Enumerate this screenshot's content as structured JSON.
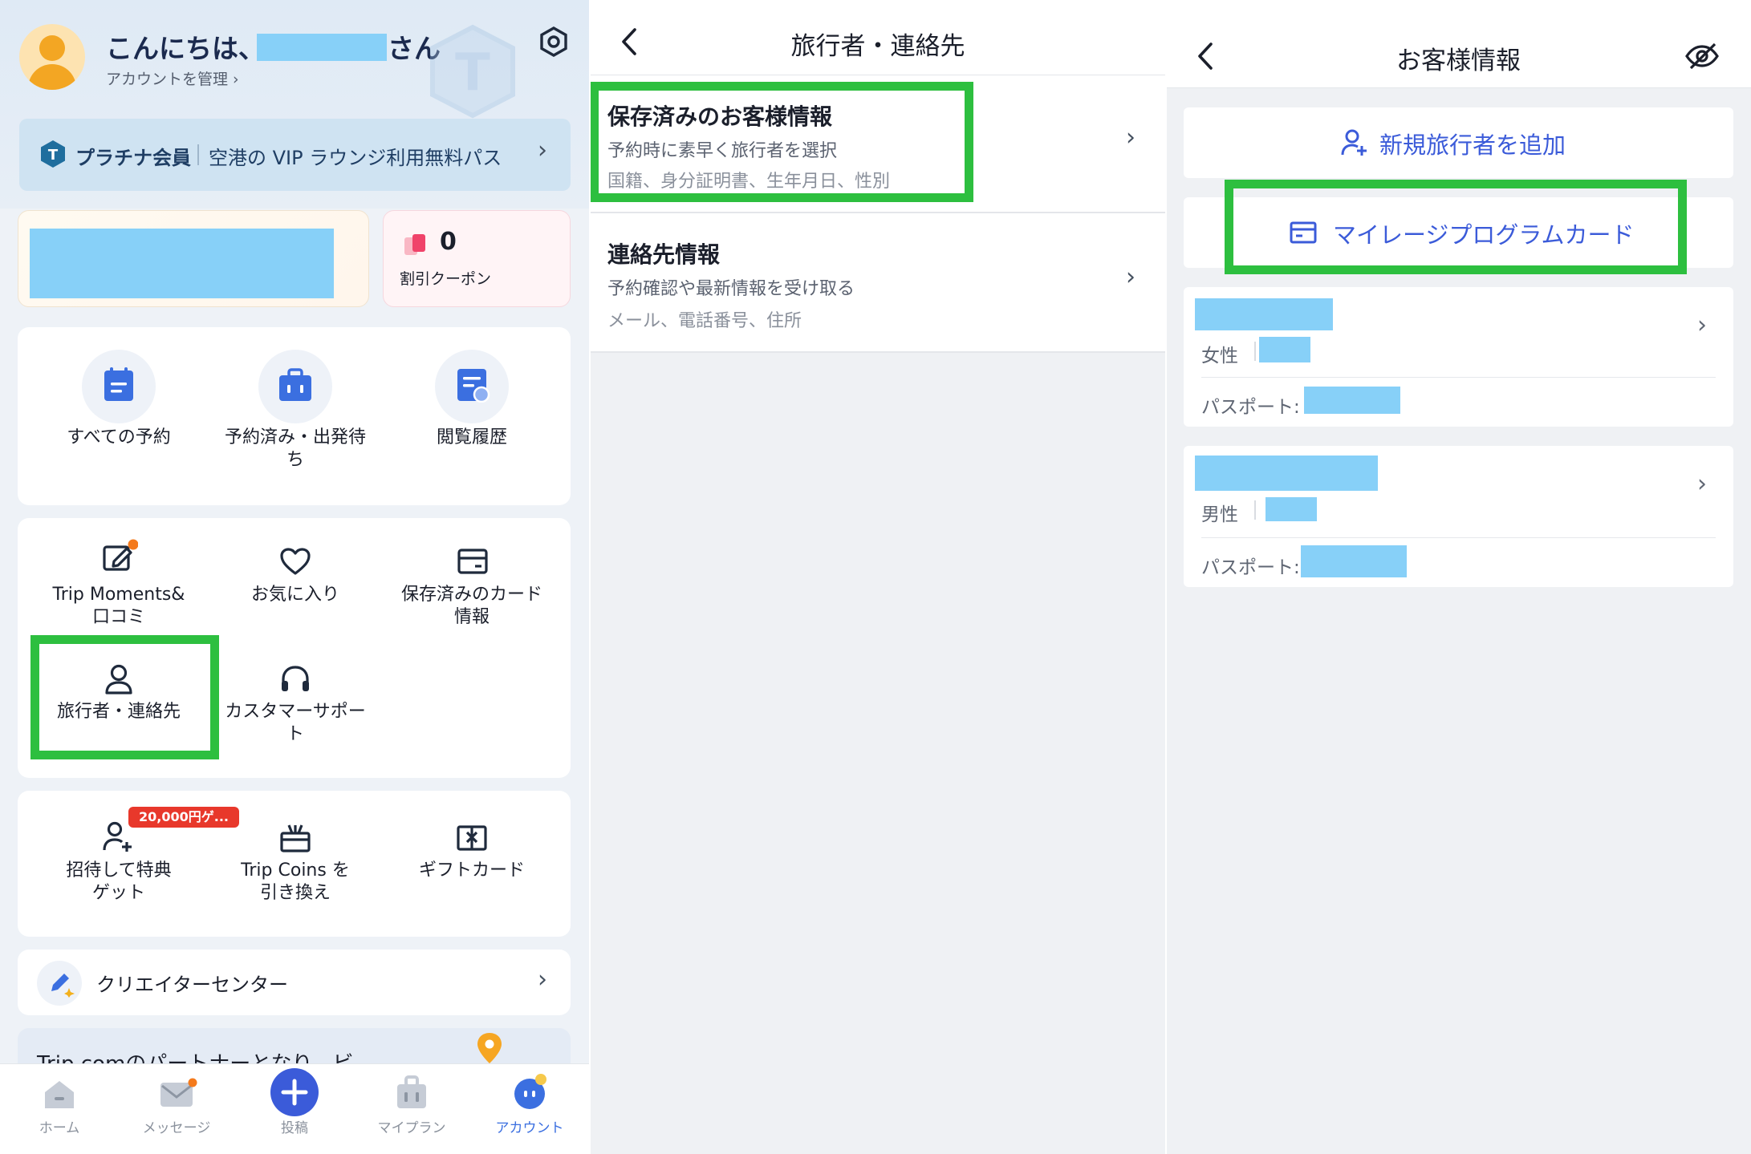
{
  "panel1": {
    "greeting": "こんにちは、",
    "greeting_suffix": "さん",
    "manage_account": "アカウントを管理 ›",
    "vip_badge_letter": "T",
    "vip_title": "プラチナ会員",
    "vip_subtitle": "空港の VIP ラウンジ利用無料パス",
    "coupon_count": "0",
    "coupon_label": "割引クーポン",
    "grid1": [
      {
        "label": "すべての予約",
        "icon": "calendar-icon"
      },
      {
        "label": "予約済み・出発待\nち",
        "icon": "suitcase-icon"
      },
      {
        "label": "閲覧履歴",
        "icon": "history-icon"
      }
    ],
    "grid2": [
      {
        "label": "Trip Moments&\n口コミ",
        "icon": "edit-note-icon"
      },
      {
        "label": "お気に入り",
        "icon": "heart-icon"
      },
      {
        "label": "保存済みのカード\n情報",
        "icon": "card-icon"
      },
      {
        "label": "旅行者・連絡先",
        "icon": "person-icon"
      },
      {
        "label": "カスタマーサポー\nト",
        "icon": "headset-icon"
      }
    ],
    "grid3": [
      {
        "label": "招待して特典\nゲット",
        "icon": "invite-icon",
        "badge": "20,000円ゲ..."
      },
      {
        "label": "Trip Coins を\n引き換え",
        "icon": "gift-box-icon"
      },
      {
        "label": "ギフトカード",
        "icon": "gift-card-icon"
      }
    ],
    "creator_center": "クリエイターセンター",
    "partner_banner": "Trip.comのパートナーとなり、ビ",
    "tabs": [
      {
        "label": "ホーム",
        "icon": "home-icon"
      },
      {
        "label": "メッセージ",
        "icon": "mail-icon"
      },
      {
        "label": "投稿",
        "icon": "plus-icon"
      },
      {
        "label": "マイプラン",
        "icon": "bag-icon"
      },
      {
        "label": "アカウント",
        "icon": "account-icon"
      }
    ]
  },
  "panel2": {
    "title": "旅行者・連絡先",
    "rows": [
      {
        "title": "保存済みのお客様情報",
        "sub1": "予約時に素早く旅行者を選択",
        "sub2": "国籍、身分証明書、生年月日、性別"
      },
      {
        "title": "連絡先情報",
        "sub1": "予約確認や最新情報を受け取る",
        "sub2": "メール、電話番号、住所"
      }
    ]
  },
  "panel3": {
    "title": "お客様情報",
    "add_traveler": "新規旅行者を追加",
    "mileage_card": "マイレージプログラムカード",
    "travelers": [
      {
        "gender": "女性",
        "passport_label": "パスポート:"
      },
      {
        "gender": "男性",
        "passport_label": "パスポート:"
      }
    ]
  },
  "colors": {
    "highlight": "#2dbf3f",
    "redaction": "#87d0f8",
    "accent_blue": "#3b5bd9",
    "tab_active": "#3b6fe0"
  }
}
